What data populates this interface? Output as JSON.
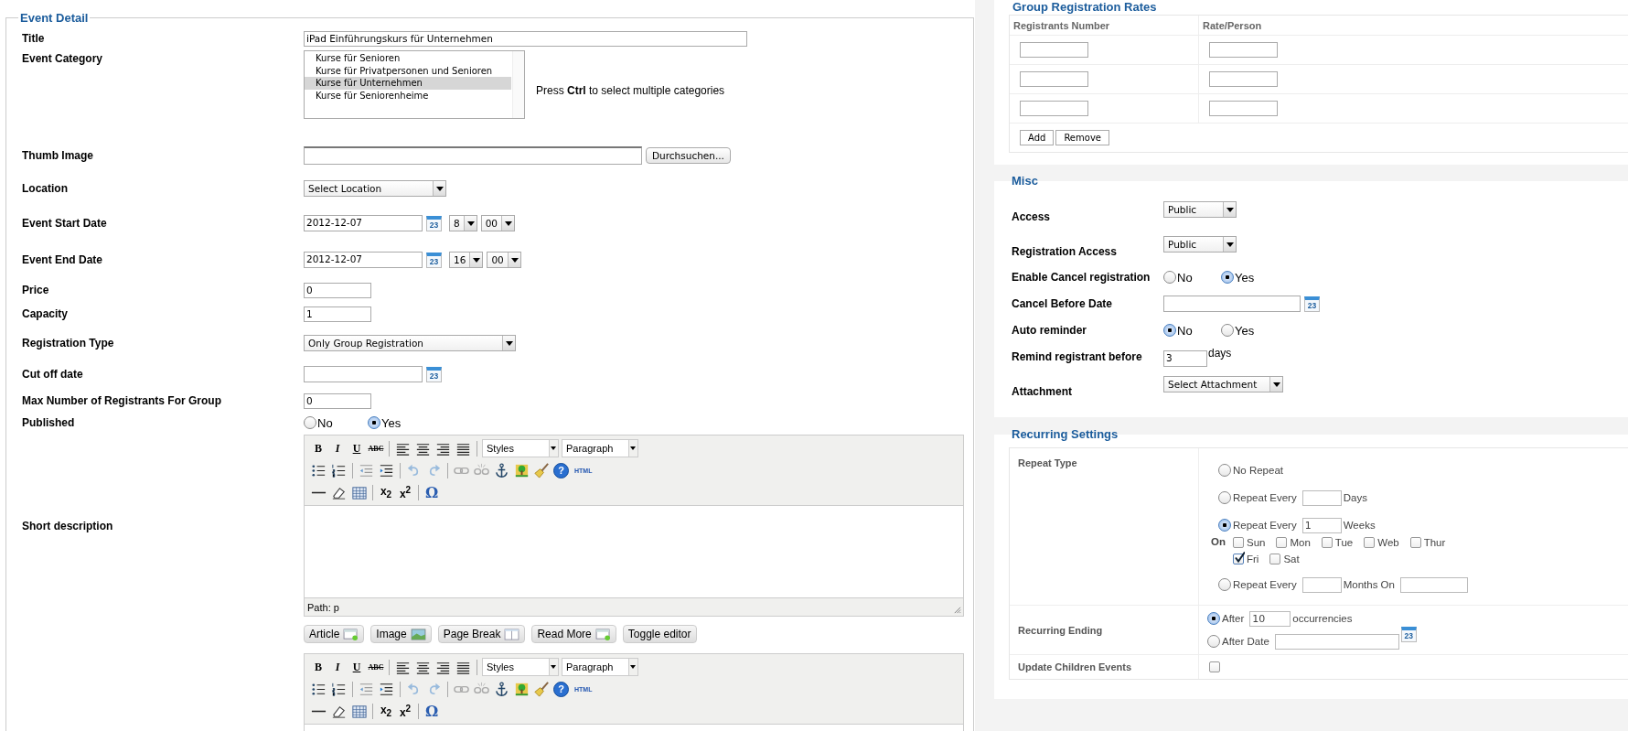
{
  "event_detail": {
    "legend": "Event Detail",
    "fields": [
      {
        "kind": "text",
        "label": "Title",
        "value": "iPad Einführungskurs für Unternehmen"
      },
      {
        "kind": "listbox",
        "label": "Event Category",
        "options": [
          {
            "text": "Kurse für Senioren",
            "selected": false
          },
          {
            "text": "Kurse für Privatpersonen und Senioren",
            "selected": false
          },
          {
            "text": "Kurse für Unternehmen",
            "selected": true
          },
          {
            "text": "Kurse für Seniorenheime",
            "selected": false
          }
        ],
        "hint": "Press **Ctrl** to select multiple categories"
      },
      {
        "kind": "file",
        "label": "Thumb Image",
        "button": "Durchsuchen..."
      },
      {
        "kind": "select",
        "label": "Location",
        "value": "Select Location"
      },
      {
        "kind": "datetime",
        "label": "Event Start Date",
        "date": "2012-12-07",
        "calendar": "23",
        "hour": "8",
        "minute": "00"
      },
      {
        "kind": "datetime",
        "label": "Event End Date",
        "date": "2012-12-07",
        "calendar": "23",
        "hour": "16",
        "minute": "00"
      },
      {
        "kind": "number",
        "label": "Price",
        "value": "0"
      },
      {
        "kind": "number",
        "label": "Capacity",
        "value": "1"
      },
      {
        "kind": "select",
        "label": "Registration Type",
        "value": "Only Group Registration"
      },
      {
        "kind": "date",
        "label": "Cut off date",
        "calendar": "23"
      },
      {
        "kind": "number",
        "label": "Max Number of Registrants For Group",
        "value": "0"
      },
      {
        "kind": "radio",
        "label": "Published",
        "options": [
          {
            "text": "No",
            "selected": false
          },
          {
            "text": "Yes",
            "selected": true
          }
        ]
      },
      {
        "kind": "editor",
        "label": "Short description",
        "toolbar": {
          "bold": "B",
          "italic": "I",
          "underline": "U",
          "strikethrough": "ABC",
          "styles": "Styles",
          "format": "Paragraph",
          "help": "?",
          "html": "HTML",
          "subscript": "x$_{2}$",
          "superscript": "x$^{2}$",
          "special_character": "Ω"
        },
        "path": "Path: p"
      },
      {
        "kind": "buttons",
        "buttons": [
          {
            "kind": "article",
            "text": "Article"
          },
          {
            "kind": "image",
            "text": "Image"
          },
          {
            "kind": "pagebreak",
            "text": "Page Break"
          },
          {
            "kind": "readmore",
            "text": "Read More"
          },
          {
            "kind": "toggle",
            "text": "Toggle editor"
          }
        ]
      },
      {
        "kind": "editor",
        "toolbar": {
          "bold": "B",
          "italic": "I",
          "underline": "U",
          "strikethrough": "ABC",
          "styles": "Styles",
          "format": "Paragraph",
          "help": "?",
          "html": "HTML",
          "subscript": "x$_{2}$",
          "superscript": "x$^{2}$",
          "special_character": "Ω"
        }
      }
    ]
  },
  "group_rates": {
    "title": "Group Registration Rates",
    "columns": [
      "Registrants Number",
      "Rate/Person"
    ],
    "buttons": [
      "Add",
      "Remove"
    ]
  },
  "misc": {
    "title": "Misc",
    "fields": [
      {
        "kind": "select",
        "label": "Access",
        "value": "Public"
      },
      {
        "kind": "select",
        "label": "Registration Access",
        "value": "Public"
      },
      {
        "kind": "radio",
        "label": "Enable Cancel registration",
        "options": [
          {
            "text": "No",
            "selected": false
          },
          {
            "text": "Yes",
            "selected": true
          }
        ]
      },
      {
        "kind": "date",
        "label": "Cancel Before Date",
        "calendar": "23"
      },
      {
        "kind": "radio",
        "label": "Auto reminder",
        "options": [
          {
            "text": "No",
            "selected": true
          },
          {
            "text": "Yes",
            "selected": false
          }
        ]
      },
      {
        "kind": "number",
        "label": "Remind registrant before",
        "value": "3",
        "suffix": "days"
      },
      {
        "kind": "select",
        "label": "Attachment",
        "value": "Select Attachment"
      }
    ]
  },
  "recurring": {
    "title": "Recurring Settings",
    "rows": [
      {
        "kind": "options",
        "label": "Repeat Type",
        "options": [
          {
            "kind": "none",
            "text": "No Repeat",
            "selected": false
          },
          {
            "kind": "days",
            "text": "Repeat Every",
            "unit": "Days",
            "selected": false
          },
          {
            "kind": "weeks",
            "text": "Repeat Every",
            "value": "1",
            "unit": "Weeks",
            "selected": true,
            "on_label": "On",
            "days": [
              {
                "text": "Sun",
                "checked": false
              },
              {
                "text": "Mon",
                "checked": false
              },
              {
                "text": "Tue",
                "checked": false
              },
              {
                "text": "Web",
                "checked": false
              },
              {
                "text": "Thur",
                "checked": false
              },
              {
                "text": "Fri",
                "checked": true
              },
              {
                "text": "Sat",
                "checked": false
              }
            ]
          },
          {
            "kind": "months",
            "text": "Repeat Every",
            "unit": "Months On",
            "selected": false
          }
        ]
      },
      {
        "kind": "options",
        "label": "Recurring Ending",
        "options": [
          {
            "kind": "count",
            "text": "After",
            "value": "10",
            "unit": "occurrencies",
            "selected": true
          },
          {
            "kind": "date",
            "text": "After Date",
            "calendar": "23",
            "selected": false
          }
        ]
      },
      {
        "kind": "check",
        "label": "Update Children Events",
        "checked": false
      }
    ]
  }
}
